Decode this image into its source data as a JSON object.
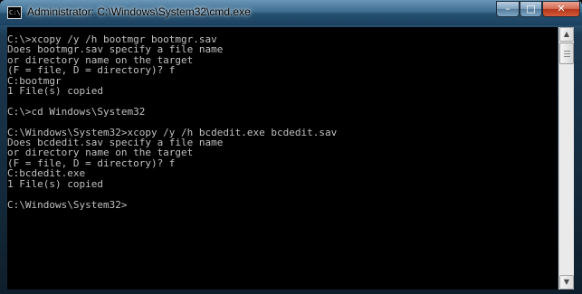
{
  "window": {
    "title": "Administrator: C:\\Windows\\System32\\cmd.exe",
    "icon_text": "C:\\"
  },
  "controls": {
    "minimize_glyph": "–",
    "maximize_glyph": "□",
    "close_glyph": "✕"
  },
  "icons": {
    "app": "cmd-console-icon",
    "minimize": "minimize-icon",
    "maximize": "maximize-icon",
    "close": "close-icon",
    "scroll_up": "scroll-up-arrow-icon",
    "scroll_down": "scroll-down-arrow-icon"
  },
  "console": {
    "background": "#000000",
    "foreground": "#c0c0c0",
    "lines": [
      "C:\\>xcopy /y /h bootmgr bootmgr.sav",
      "Does bootmgr.sav specify a file name",
      "or directory name on the target",
      "(F = file, D = directory)? f",
      "C:bootmgr",
      "1 File(s) copied",
      "",
      "C:\\>cd Windows\\System32",
      "",
      "C:\\Windows\\System32>xcopy /y /h bcdedit.exe bcdedit.sav",
      "Does bcdedit.sav specify a file name",
      "or directory name on the target",
      "(F = file, D = directory)? f",
      "C:bcdedit.exe",
      "1 File(s) copied",
      "",
      "C:\\Windows\\System32>"
    ]
  },
  "scrollbar": {
    "up_glyph": "▲",
    "down_glyph": "▼"
  }
}
